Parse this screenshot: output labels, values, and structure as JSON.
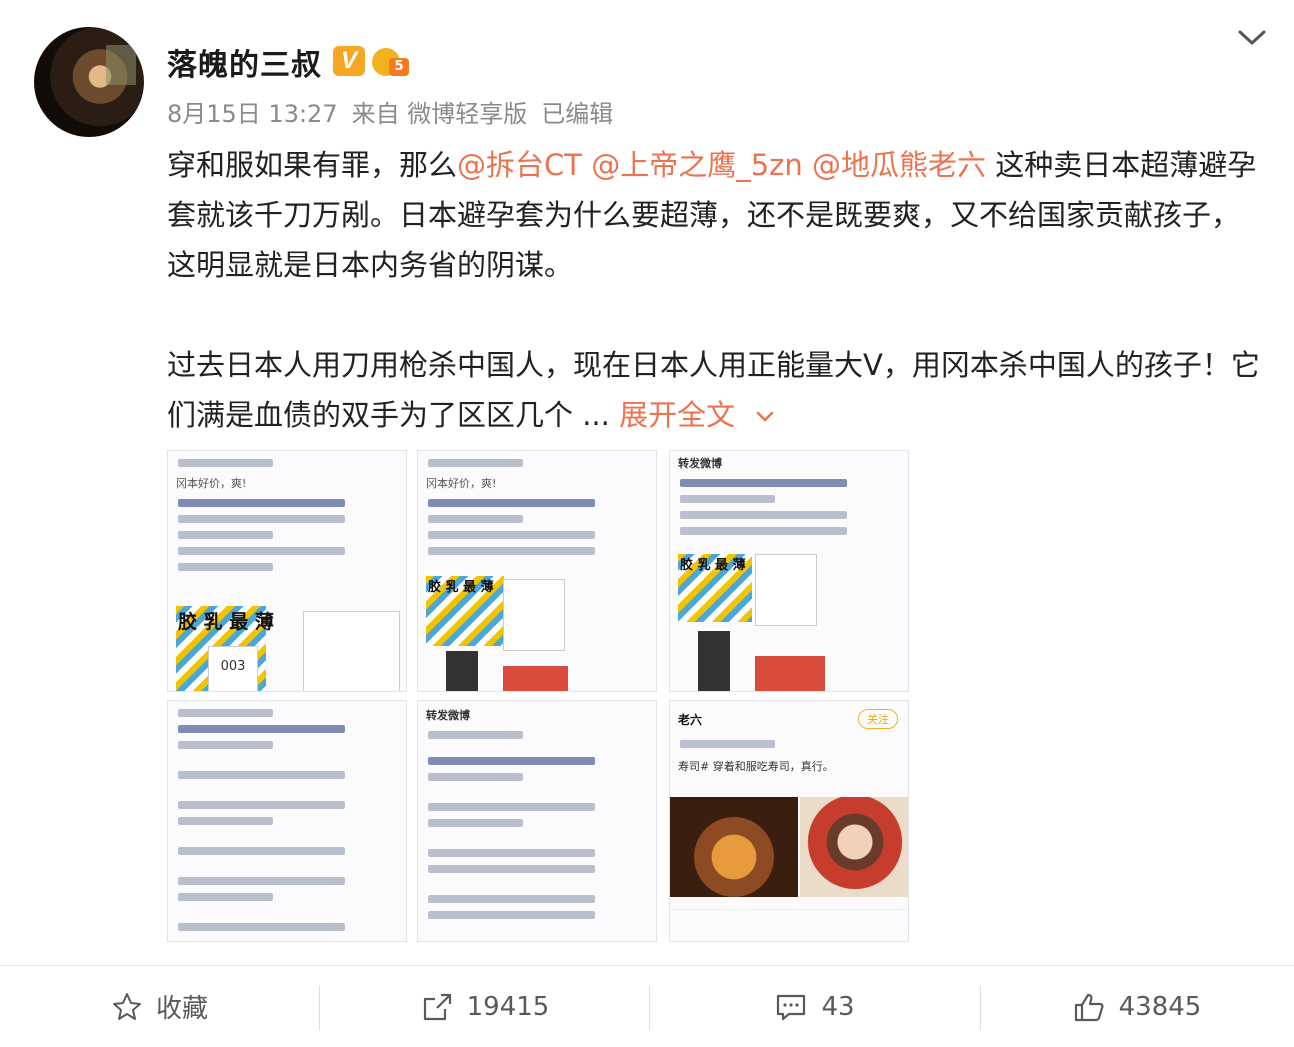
{
  "user": {
    "name": "落魄的三叔",
    "verified_badge": "V",
    "level_badge": "5",
    "timestamp": "8月15日 13:27",
    "source": "来自 微博轻享版",
    "edited": "已编辑"
  },
  "post": {
    "p1_prefix": "穿和服如果有罪，那么",
    "mention1": "@拆台CT",
    "mention2": "@上帝之鹰_5zn",
    "mention3": "@地瓜熊老六",
    "p1_suffix": " 这种卖日本超薄避孕套就该千刀万剐。日本避孕套为什么要超薄，还不是既要爽，又不给国家贡献孩子，这明显就是日本内务省的阴谋。",
    "p2_text": "过去日本人用刀用枪杀中国人，现在日本人用正能量大V，用冈本杀中国人的孩子！它们满是血债的双手为了区区几个 ... ",
    "expand_label": "展开全文"
  },
  "images": {
    "img1_text": "冈本好价，爽!",
    "img1_product": "胶 乳 最 薄",
    "img1_code": "003",
    "img2_text": "冈本好价，爽!",
    "img2_product": "胶 乳 最 薄",
    "img3_header": "转发微博",
    "img3_product": "胶 乳 最 薄",
    "img8_header": "转发微博",
    "img9_header": "老六",
    "img9_tag": "关注",
    "img9_text": "寿司# 穿着和服吃寿司，真行。"
  },
  "actions": {
    "favorite_label": "收藏",
    "repost_count": "19415",
    "comment_count": "43",
    "like_count": "43845"
  },
  "colors": {
    "accent": "#eb7350",
    "muted": "#8a8a8a",
    "badge": "#f6a623"
  }
}
